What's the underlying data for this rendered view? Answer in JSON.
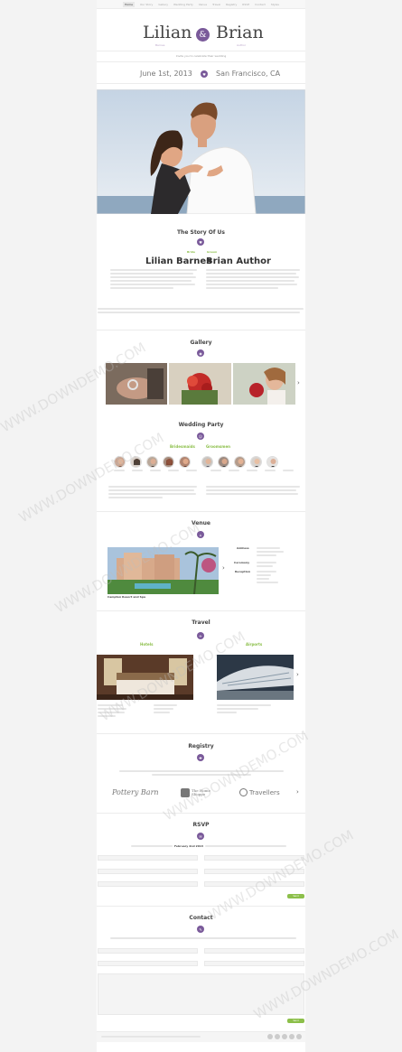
{
  "nav": {
    "items": [
      "Home",
      "Our Story",
      "Gallery",
      "Wedding Party",
      "Venue",
      "Travel",
      "Registry",
      "RSVP",
      "Contact",
      "Styles"
    ]
  },
  "header": {
    "bride_first": "Lilian",
    "groom_first": "Brian",
    "bride_sub": "Barnes",
    "groom_sub": "Author",
    "amp": "&",
    "invite": "Invite you to celebrate their wedding",
    "date": "June 1st, 2013",
    "location": "San Francisco, CA"
  },
  "story": {
    "title": "The Story Of Us",
    "bride_tag": "Bride",
    "groom_tag": "Groom",
    "bride_name": "Lilian Barnes",
    "groom_name": "Brian Author"
  },
  "gallery": {
    "title": "Gallery"
  },
  "wedding_party": {
    "title": "Wedding Party",
    "bridesmaids_label": "Bridesmaids",
    "groomsmen_label": "Groomsmen"
  },
  "venue": {
    "title": "Venue",
    "caption": "Campton Resort and Spa",
    "address_label": "Address",
    "ceremony_label": "Ceremony",
    "reception_label": "Reception"
  },
  "travel": {
    "title": "Travel",
    "hotels_label": "Hotels",
    "airports_label": "Airports"
  },
  "registry": {
    "title": "Registry",
    "logo1": "Pottery Barn",
    "logo2": "The Home Shoppe",
    "logo3": "Travellers"
  },
  "rsvp": {
    "title": "RSVP",
    "date_highlight": "February 2nd 2013",
    "send_label": "Send"
  },
  "contact": {
    "title": "Contact",
    "send_label": "Send"
  },
  "watermark": "WWW.DOWNDEMO.COM",
  "colors": {
    "accent": "#7a5a9a",
    "green": "#8cbf4a"
  }
}
